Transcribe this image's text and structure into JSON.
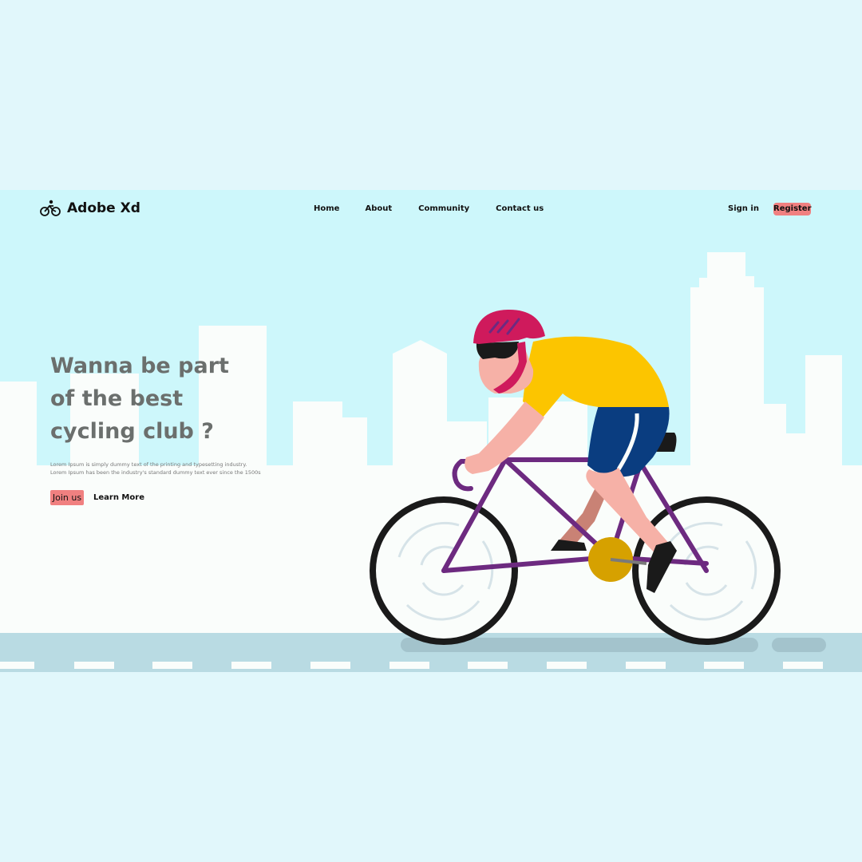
{
  "brand": {
    "logo_icon": "cyclist-logo-icon",
    "name": "Adobe Xd"
  },
  "nav": {
    "items": [
      {
        "label": "Home"
      },
      {
        "label": "About"
      },
      {
        "label": "Community"
      },
      {
        "label": "Contact us"
      }
    ]
  },
  "auth": {
    "sign_in_label": "Sign in",
    "register_label": "Register"
  },
  "hero": {
    "title_lines": [
      "Wanna be part",
      "of the best",
      "cycling club ?"
    ],
    "description_lines": [
      "Lorem Ipsum is simply dummy text of the printing and typesetting industry.",
      "Lorem Ipsum has been the industry's standard dummy text ever since the 1500s"
    ],
    "join_label": "Join us",
    "learn_more_label": "Learn More"
  },
  "colors": {
    "background": "#e1f7fb",
    "sky": "#cdf7fb",
    "accent": "#f08080",
    "heading": "#6b6f6d",
    "jersey": "#fcc500",
    "helmet": "#cf1a5c",
    "bike_frame": "#6d2a80",
    "shorts": "#0a3d80",
    "road": "#b9dbe3"
  }
}
